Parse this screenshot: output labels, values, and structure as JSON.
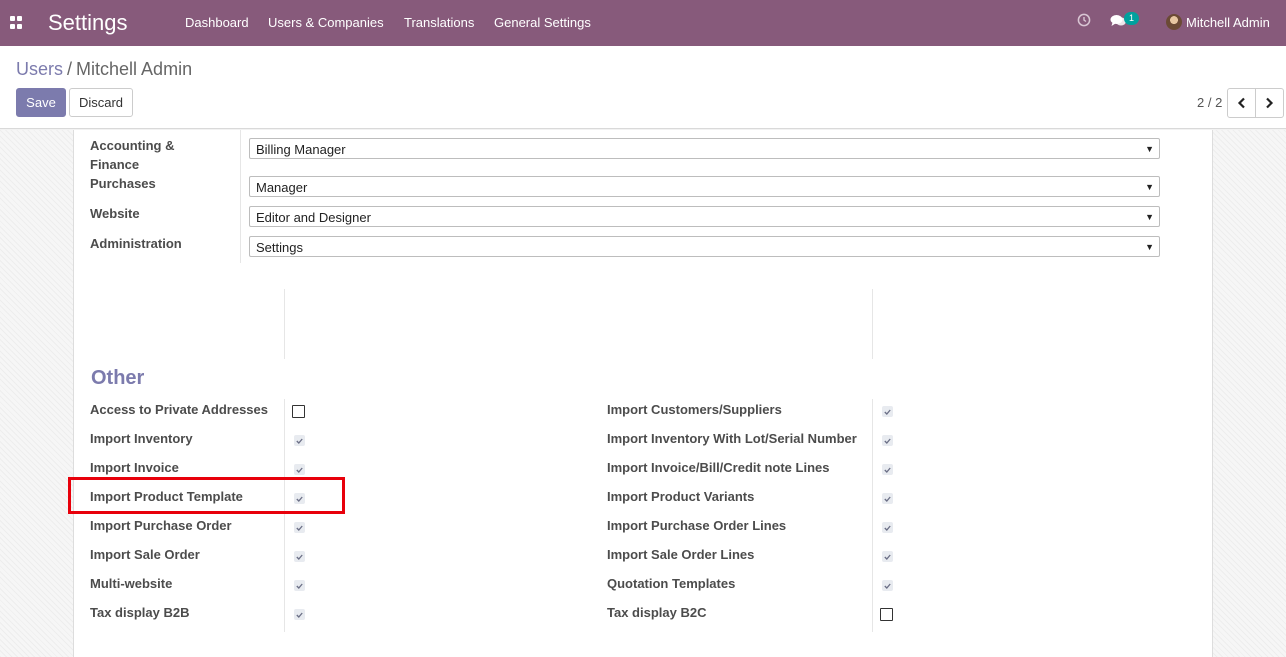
{
  "navbar": {
    "app_title": "Settings",
    "menu": [
      "Dashboard",
      "Users & Companies",
      "Translations",
      "General Settings"
    ],
    "chat_count": "1",
    "user_name": "Mitchell Admin",
    "icons": [
      "apps-icon",
      "clock-icon",
      "chat-icon",
      "avatar"
    ]
  },
  "breadcrumb": {
    "parent": "Users",
    "separator": "/",
    "current": "Mitchell Admin"
  },
  "actions": {
    "save_label": "Save",
    "discard_label": "Discard"
  },
  "pager": {
    "value": "2 / 2"
  },
  "access_rights": [
    {
      "label_line1": "Accounting &",
      "label_line2": "Finance",
      "value": "Billing Manager"
    },
    {
      "label": "Purchases",
      "value": "Manager"
    },
    {
      "label": "Website",
      "value": "Editor and Designer"
    },
    {
      "label": "Administration",
      "value": "Settings"
    }
  ],
  "other": {
    "title": "Other",
    "left": [
      {
        "label": "Access to Private Addresses",
        "checked": false
      },
      {
        "label": "Import Inventory",
        "checked": true
      },
      {
        "label": "Import Invoice",
        "checked": true
      },
      {
        "label": "Import Product Template",
        "checked": true
      },
      {
        "label": "Import Purchase Order",
        "checked": true
      },
      {
        "label": "Import Sale Order",
        "checked": true
      },
      {
        "label": "Multi-website",
        "checked": true
      },
      {
        "label": "Tax display B2B",
        "checked": true
      }
    ],
    "right": [
      {
        "label": "Import Customers/Suppliers",
        "checked": true
      },
      {
        "label": "Import Inventory With Lot/Serial Number",
        "checked": true
      },
      {
        "label": "Import Invoice/Bill/Credit note Lines",
        "checked": true
      },
      {
        "label": "Import Product Variants",
        "checked": true
      },
      {
        "label": "Import Purchase Order Lines",
        "checked": true
      },
      {
        "label": "Import Sale Order Lines",
        "checked": true
      },
      {
        "label": "Quotation Templates",
        "checked": true
      },
      {
        "label": "Tax display B2C",
        "checked": false
      }
    ]
  },
  "colors": {
    "navbar": "#875a7b",
    "primary": "#7c7bad",
    "highlight": "#e8000b",
    "badge": "#00a09d"
  }
}
